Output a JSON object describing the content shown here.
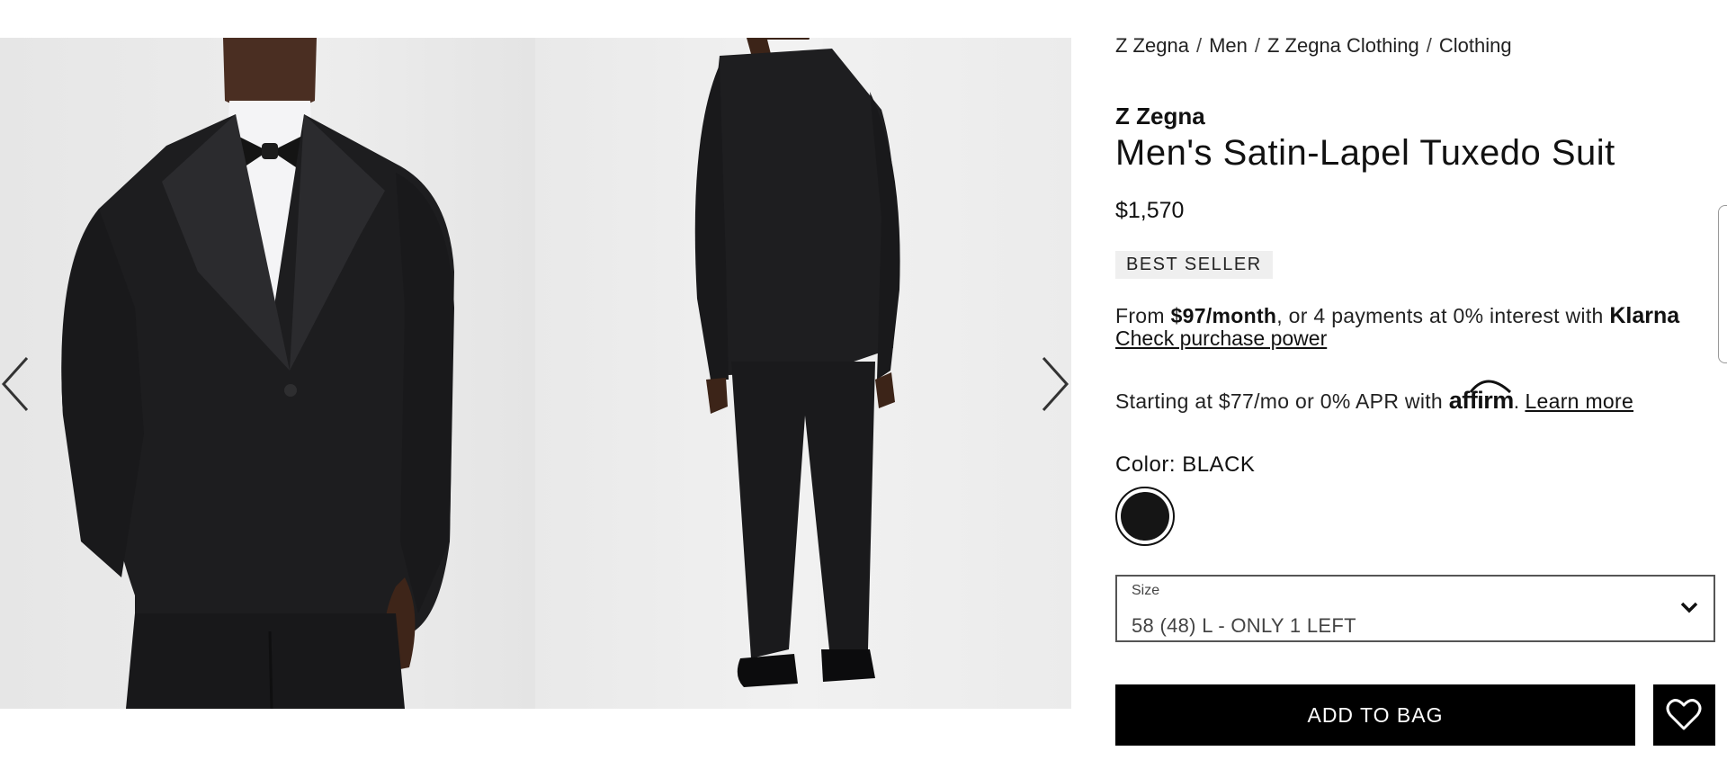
{
  "gallery": {
    "images": [
      {
        "alt": "Men's Satin-Lapel Tuxedo Suit front view"
      },
      {
        "alt": "Men's Satin-Lapel Tuxedo Suit back view"
      }
    ],
    "prev_icon": "chevron-left-icon",
    "next_icon": "chevron-right-icon"
  },
  "breadcrumb": [
    "Z Zegna",
    "Men",
    "Z Zegna Clothing",
    "Clothing"
  ],
  "breadcrumb_separator": "/",
  "product": {
    "brand": "Z Zegna",
    "name": "Men's Satin-Lapel Tuxedo Suit",
    "price": "$1,570",
    "badge": "BEST SELLER"
  },
  "klarna": {
    "prefix": "From ",
    "amount": "$97/month",
    "middle": ", or 4 payments at 0% interest with ",
    "logo": "Klarna",
    "link": "Check purchase power"
  },
  "affirm": {
    "text": "Starting at $77/mo or 0% APR with ",
    "logo": "affirm",
    "dot": ".",
    "link": "Learn more"
  },
  "color": {
    "label": "Color:",
    "value": "BLACK",
    "swatch_hex": "#151515"
  },
  "size": {
    "caption": "Size",
    "selected": "58 (48) L - ONLY 1 LEFT",
    "icon": "chevron-down-icon"
  },
  "actions": {
    "add_to_bag": "ADD TO BAG",
    "wishlist_icon": "heart-icon"
  }
}
